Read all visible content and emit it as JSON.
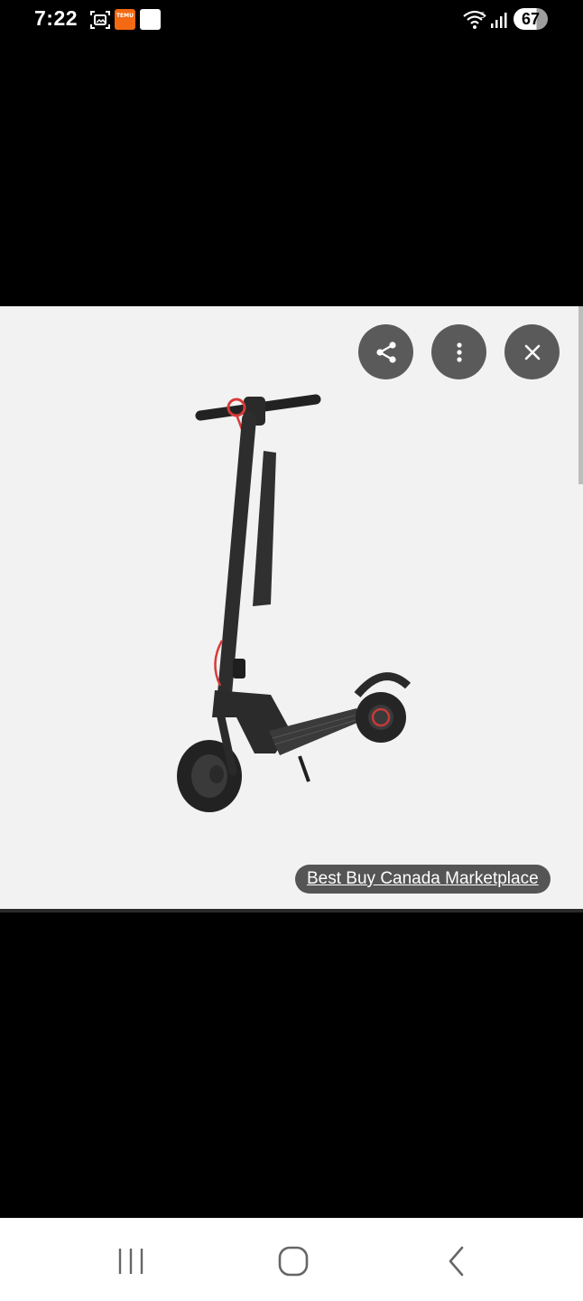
{
  "status_bar": {
    "time": "7:22",
    "battery": "67",
    "temu_label": "TEMU",
    "icons": [
      "screenshot-icon",
      "temu-app-icon",
      "notification-app-icon",
      "wifi-icon",
      "signal-icon",
      "battery-icon"
    ]
  },
  "viewer": {
    "image_subject": "electric kick scooter",
    "actions": [
      "share",
      "more-options",
      "close"
    ],
    "source_label": "Best Buy Canada Marketplace"
  },
  "nav_bar": {
    "buttons": [
      "recent-apps",
      "home",
      "back"
    ]
  },
  "colors": {
    "viewer_bg": "#f2f2f2",
    "action_button_bg": "#5a5a5a",
    "scooter_body": "#2b2b2b",
    "brake_cable": "#e03030",
    "temu_orange": "#f36a12"
  }
}
